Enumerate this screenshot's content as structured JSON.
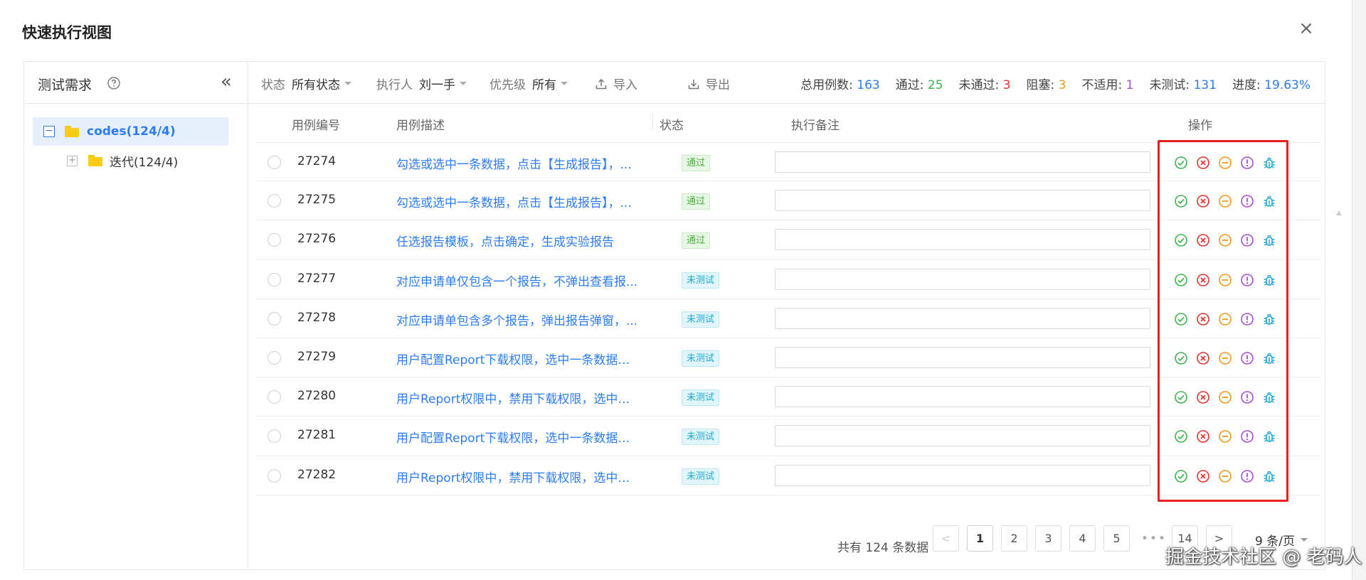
{
  "dialog": {
    "title": "快速执行视图",
    "close_label": "×"
  },
  "sidebar": {
    "title": "测试需求",
    "collapse_label": "«",
    "tree": {
      "root_label": "codes(124/4)",
      "root_toggle": "−",
      "child_label": "迭代(124/4)",
      "child_toggle": "+"
    }
  },
  "toolbar": {
    "status_label": "状态",
    "status_value": "所有状态",
    "executor_label": "执行人",
    "executor_value": "刘一手",
    "priority_label": "优先级",
    "priority_value": "所有",
    "import_label": "导入",
    "export_label": "导出"
  },
  "stats": {
    "total_label": "总用例数:",
    "total": "163",
    "pass_label": "通过:",
    "pass": "25",
    "fail_label": "未通过:",
    "fail": "3",
    "blocked_label": "阻塞:",
    "blocked": "3",
    "na_label": "不适用:",
    "na": "1",
    "untested_label": "未测试:",
    "untested": "131",
    "progress_label": "进度:",
    "progress": "19.63%"
  },
  "table": {
    "columns": [
      "用例编号",
      "用例描述",
      "状态",
      "执行备注",
      "操作"
    ],
    "rows": [
      {
        "id": "27274",
        "desc": "勾选或选中一条数据，点击【生成报告】，...",
        "status": "通过",
        "status_kind": "pass"
      },
      {
        "id": "27275",
        "desc": "勾选或选中一条数据，点击【生成报告】，...",
        "status": "通过",
        "status_kind": "pass"
      },
      {
        "id": "27276",
        "desc": "任选报告模板，点击确定，生成实验报告",
        "status": "通过",
        "status_kind": "pass"
      },
      {
        "id": "27277",
        "desc": "对应申请单仅包含一个报告，不弹出查看报...",
        "status": "未测试",
        "status_kind": "untested"
      },
      {
        "id": "27278",
        "desc": "对应申请单包含多个报告，弹出报告弹窗，...",
        "status": "未测试",
        "status_kind": "untested"
      },
      {
        "id": "27279",
        "desc": "用户配置Report下载权限，选中一条数据点...",
        "status": "未测试",
        "status_kind": "untested"
      },
      {
        "id": "27280",
        "desc": "用户Report权限中，禁用下载权限，选中一...",
        "status": "未测试",
        "status_kind": "untested"
      },
      {
        "id": "27281",
        "desc": "用户配置Report下载权限，选中一条数据点...",
        "status": "未测试",
        "status_kind": "untested"
      },
      {
        "id": "27282",
        "desc": "用户Report权限中，禁用下载权限，选中一...",
        "status": "未测试",
        "status_kind": "untested"
      }
    ],
    "action_icons": [
      "pass-icon",
      "fail-icon",
      "blocked-icon",
      "not-applicable-icon",
      "bug-icon"
    ]
  },
  "colors": {
    "accent": "#2d7cf0",
    "pass": "#3fb34f",
    "fail": "#e0332e",
    "blocked": "#ef9a1a",
    "na": "#a64bd8",
    "bug": "#1fa7cf",
    "highlight": "#e82020"
  },
  "pagination": {
    "total_text": "共有 124 条数据",
    "prev": "<",
    "pages": [
      "1",
      "2",
      "3",
      "4",
      "5"
    ],
    "ellipsis": "•••",
    "last_page": "14",
    "next": ">",
    "page_size": "9 条/页"
  },
  "watermark": "掘金技术社区 @ 老码人"
}
